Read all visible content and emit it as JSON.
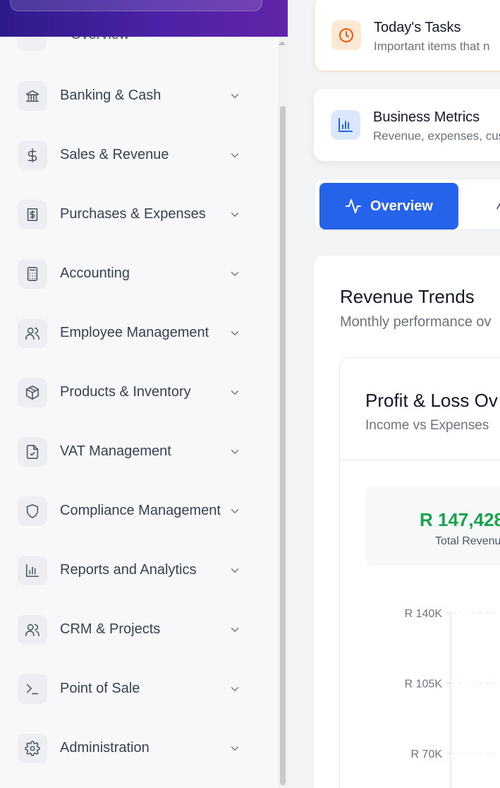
{
  "sidebar": {
    "overview_label": "Overview",
    "items": [
      {
        "label": "Banking & Cash",
        "icon": "bank-icon"
      },
      {
        "label": "Sales & Revenue",
        "icon": "dollar-icon"
      },
      {
        "label": "Purchases & Expenses",
        "icon": "receipt-icon"
      },
      {
        "label": "Accounting",
        "icon": "calculator-icon"
      },
      {
        "label": "Employee Management",
        "icon": "users-icon"
      },
      {
        "label": "Products & Inventory",
        "icon": "package-icon"
      },
      {
        "label": "VAT Management",
        "icon": "file-check-icon"
      },
      {
        "label": "Compliance Management",
        "icon": "shield-icon"
      },
      {
        "label": "Reports and Analytics",
        "icon": "bar-chart-icon"
      },
      {
        "label": "CRM & Projects",
        "icon": "users-icon"
      },
      {
        "label": "Point of Sale",
        "icon": "terminal-icon"
      },
      {
        "label": "Administration",
        "icon": "gear-icon"
      }
    ]
  },
  "main": {
    "tasks_card": {
      "title": "Today's Tasks",
      "subtitle": "Important items that n",
      "icon": "clock-icon"
    },
    "metrics_card": {
      "title": "Business Metrics",
      "subtitle": "Revenue, expenses, cus",
      "icon": "bar-chart-icon"
    },
    "tabs": {
      "active_label": "Overview",
      "active_icon": "activity-icon"
    },
    "trends": {
      "title": "Revenue Trends",
      "subtitle": "Monthly performance ov",
      "pl_card": {
        "title": "Profit & Loss Ov",
        "subtitle": "Income vs Expenses",
        "stat_value": "R 147,428",
        "stat_label": "Total Revenu"
      }
    }
  },
  "colors": {
    "accent": "#2563eb",
    "profit": "#16a34a",
    "header_start": "#2e1a8a",
    "header_end": "#6224a8"
  },
  "chart_data": {
    "type": "line",
    "ylim": [
      70000,
      140000
    ],
    "y_tick_values": [
      140000,
      105000,
      70000
    ],
    "y_tick_labels": [
      "R 140K",
      "R 105K",
      "R 70K"
    ],
    "grid": true
  }
}
